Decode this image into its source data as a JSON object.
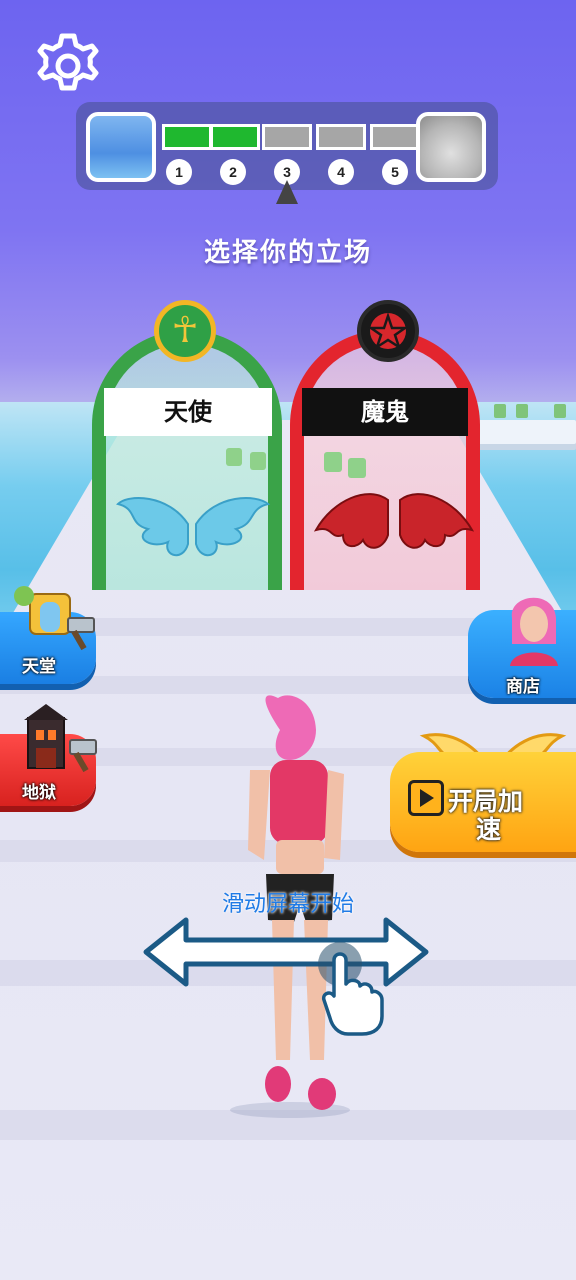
{
  "progress": {
    "levels": [
      "1",
      "2",
      "3",
      "4",
      "5"
    ],
    "completed_levels": 2,
    "current_level": "3"
  },
  "title": "选择你的立场",
  "gates": {
    "angel": {
      "label": "天使",
      "emblem_icon": "ankh-icon",
      "color": "#3aa348"
    },
    "demon": {
      "label": "魔鬼",
      "emblem_icon": "pentagram-icon",
      "color": "#e3252e"
    }
  },
  "buttons": {
    "heaven": "天堂",
    "hell": "地狱",
    "shop": "商店",
    "boost": "开局加速"
  },
  "swipe_hint": "滑动屏幕开始",
  "colors": {
    "progress_done": "#1fb82f",
    "progress_todo": "#a6a6a6",
    "hint_text": "#1f7be6"
  }
}
